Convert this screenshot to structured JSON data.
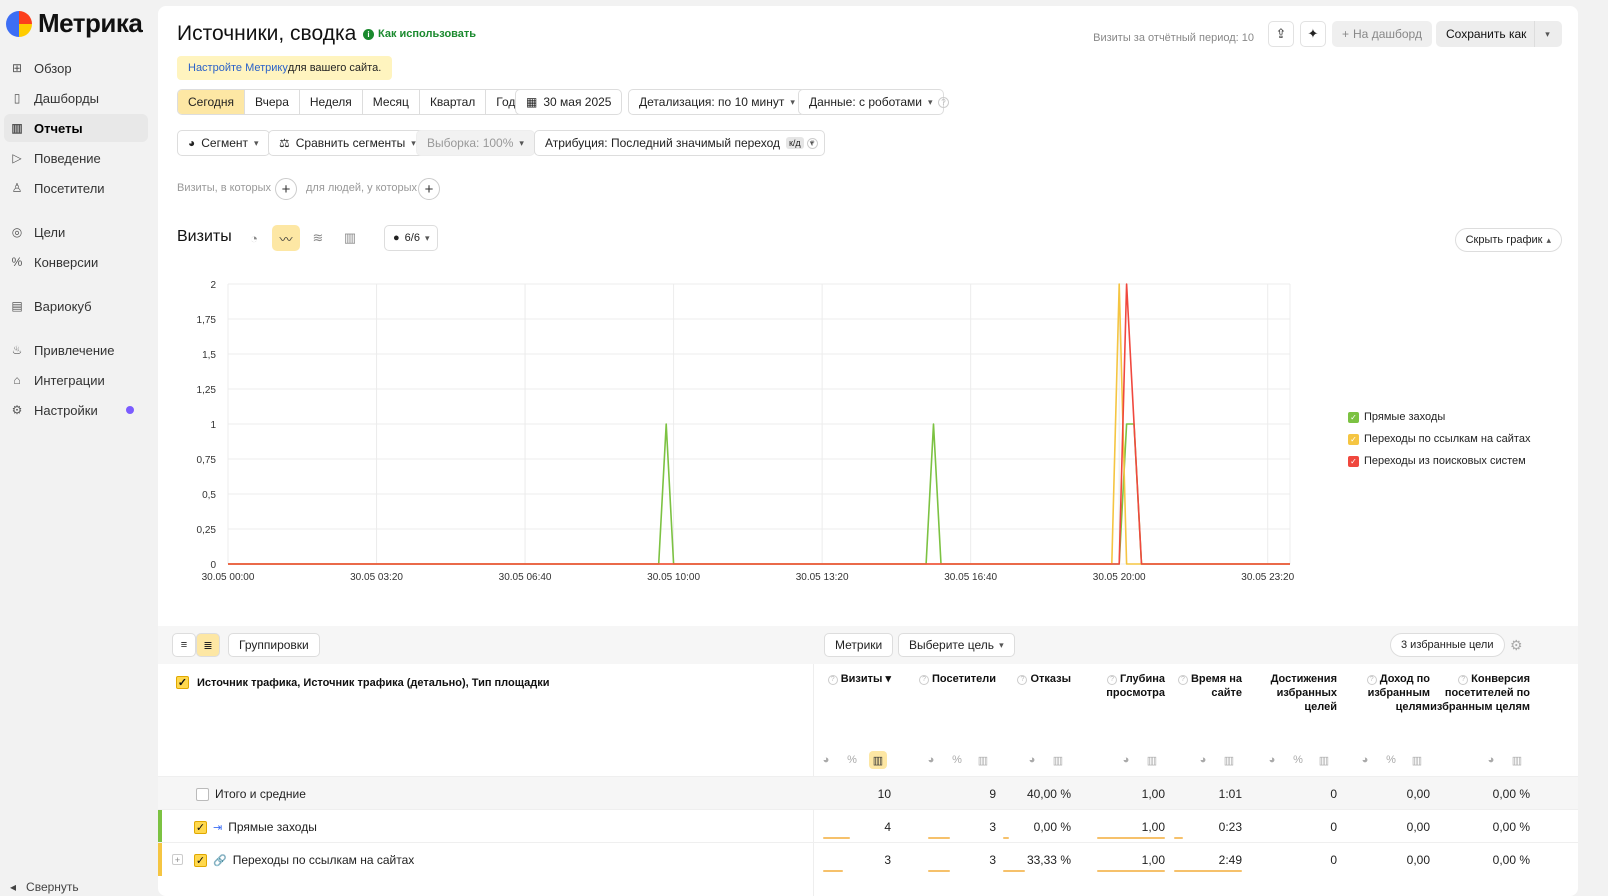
{
  "sidebar": {
    "logo": "Метрика",
    "items": [
      {
        "label": "Обзор",
        "icon": "grid-icon"
      },
      {
        "label": "Дашборды",
        "icon": "dashboard-icon"
      },
      {
        "label": "Отчеты",
        "icon": "reports-icon"
      },
      {
        "label": "Поведение",
        "icon": "play-icon"
      },
      {
        "label": "Посетители",
        "icon": "user-icon"
      },
      {
        "label": "Цели",
        "icon": "target-icon"
      },
      {
        "label": "Конверсии",
        "icon": "percent-icon"
      },
      {
        "label": "Вариокуб",
        "icon": "cube-icon"
      },
      {
        "label": "Привлечение",
        "icon": "flame-icon"
      },
      {
        "label": "Интеграции",
        "icon": "plug-icon"
      },
      {
        "label": "Настройки",
        "icon": "gear-icon"
      }
    ],
    "collapse_label": "Свернуть"
  },
  "header": {
    "title": "Источники, сводка",
    "howto": "Как использовать",
    "visits_period": "Визиты за отчётный период: 10",
    "to_dashboard": "На дашборд",
    "save_as": "Сохранить как"
  },
  "notice": {
    "link": "Настройте Метрику",
    "text": " для вашего сайта."
  },
  "periods": [
    "Сегодня",
    "Вчера",
    "Неделя",
    "Месяц",
    "Квартал",
    "Год"
  ],
  "date": "30 мая 2025",
  "detail": "Детализация: по 10 минут",
  "robots": "Данные: с роботами",
  "segment": "Сегмент",
  "compare": "Сравнить сегменты",
  "sample": "Выборка: 100%",
  "attribution": "Атрибуция: Последний значимый переход",
  "attribution_badge": "к/д",
  "filter_visits": "Визиты, в которых",
  "filter_people": "для людей, у которых",
  "chart_header": {
    "title": "Визиты",
    "series_count": "6/6",
    "hide": "Скрыть график"
  },
  "chart_data": {
    "type": "line",
    "x_ticks": [
      "30.05 00:00",
      "30.05 03:20",
      "30.05 06:40",
      "30.05 10:00",
      "30.05 13:20",
      "30.05 16:40",
      "30.05 20:00",
      "30.05 23:20"
    ],
    "y_ticks": [
      "0",
      "0,25",
      "0,5",
      "0,75",
      "1",
      "1,25",
      "1,5",
      "1,75",
      "2"
    ],
    "ylim": [
      0,
      2
    ],
    "x_minutes_range": [
      0,
      1430
    ],
    "series": [
      {
        "name": "Прямые заходы",
        "color": "#7cc242",
        "points": [
          [
            0,
            0
          ],
          [
            580,
            0
          ],
          [
            590,
            1
          ],
          [
            600,
            0
          ],
          [
            940,
            0
          ],
          [
            950,
            1
          ],
          [
            960,
            0
          ],
          [
            1200,
            0
          ],
          [
            1210,
            1
          ],
          [
            1220,
            1
          ],
          [
            1230,
            0
          ],
          [
            1430,
            0
          ]
        ]
      },
      {
        "name": "Переходы по ссылкам на сайтах",
        "color": "#f5c542",
        "points": [
          [
            0,
            0
          ],
          [
            1190,
            0
          ],
          [
            1200,
            2
          ],
          [
            1210,
            0
          ],
          [
            1430,
            0
          ]
        ]
      },
      {
        "name": "Переходы из поисковых систем",
        "color": "#f0483e",
        "points": [
          [
            0,
            0
          ],
          [
            1200,
            0
          ],
          [
            1210,
            2
          ],
          [
            1230,
            0
          ],
          [
            1430,
            0
          ]
        ]
      }
    ]
  },
  "table": {
    "view_groupings": "Группировки",
    "metrics": "Метрики",
    "choose_goal": "Выберите цель",
    "fav_goals": "3 избранные цели",
    "dim_header": "Источник трафика, Источник трафика (детально), Тип площадки",
    "columns": [
      {
        "label": "Визиты ▾",
        "help": true
      },
      {
        "label": "Посетители",
        "help": true
      },
      {
        "label": "Отказы",
        "help": true
      },
      {
        "label": "Глубина просмотра",
        "help": true
      },
      {
        "label": "Время на сайте",
        "help": true
      },
      {
        "label": "Достижения избранных целей",
        "help": false
      },
      {
        "label": "Доход по избранным целям",
        "help": true
      },
      {
        "label": "Конверсия посетителей по избранным целям",
        "help": true
      }
    ],
    "rows": [
      {
        "label": "Итого и средние",
        "values": [
          "10",
          "9",
          "40,00 %",
          "1,00",
          "1:01",
          "0",
          "0,00",
          "0,00 %"
        ]
      },
      {
        "label": "Прямые заходы",
        "values": [
          "4",
          "3",
          "0,00 %",
          "1,00",
          "0:23",
          "0",
          "0,00",
          "0,00 %"
        ],
        "color": "#7cc242",
        "share": [
          0.4,
          0.33,
          0.0,
          1.0,
          0.13
        ]
      },
      {
        "label": "Переходы по ссылкам на сайтах",
        "values": [
          "3",
          "3",
          "33,33 %",
          "1,00",
          "2:49",
          "0",
          "0,00",
          "0,00 %"
        ],
        "color": "#f5c542",
        "share": [
          0.3,
          0.33,
          0.33,
          1.0,
          1.0
        ]
      }
    ]
  }
}
